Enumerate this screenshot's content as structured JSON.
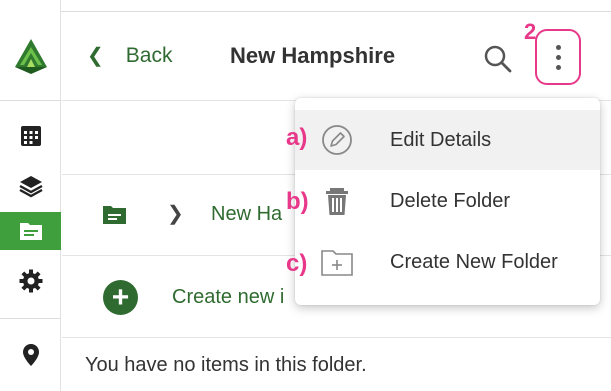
{
  "header": {
    "back_label": "Back",
    "title": "New Hampshire"
  },
  "annotations": {
    "step": "2",
    "a": "a)",
    "b": "b)",
    "c": "c)"
  },
  "breadcrumb": {
    "folder_name": "New Ha"
  },
  "create_new_label": "Create new i",
  "empty_message": "You have no items in this folder.",
  "menu": {
    "items": [
      {
        "label": "Edit Details",
        "icon": "pencil-icon"
      },
      {
        "label": "Delete Folder",
        "icon": "trash-icon"
      },
      {
        "label": "Create New Folder",
        "icon": "folder-plus-icon"
      }
    ]
  },
  "sidebar": {
    "items": [
      {
        "icon": "calendar-grid-icon"
      },
      {
        "icon": "layers-icon"
      },
      {
        "icon": "folder-icon",
        "active": true
      },
      {
        "icon": "gear-icon"
      },
      {
        "icon": "location-pin-icon"
      }
    ]
  },
  "colors": {
    "accent_green": "#3f9f3c",
    "dark_green": "#2f6b30",
    "annotation_pink": "#e8388a"
  }
}
